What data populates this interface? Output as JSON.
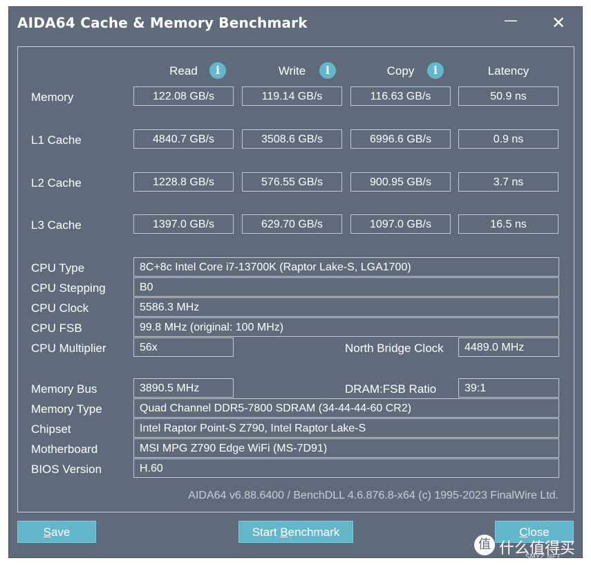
{
  "window": {
    "title": "AIDA64 Cache & Memory Benchmark",
    "minimize_glyph": "—",
    "close_glyph": "✕"
  },
  "columns": {
    "read": "Read",
    "write": "Write",
    "copy": "Copy",
    "latency": "Latency",
    "info_glyph": "i"
  },
  "rows": [
    {
      "label": "Memory",
      "read": "122.08 GB/s",
      "write": "119.14 GB/s",
      "copy": "116.63 GB/s",
      "latency": "50.9 ns"
    },
    {
      "label": "L1 Cache",
      "read": "4840.7 GB/s",
      "write": "3508.6 GB/s",
      "copy": "6996.6 GB/s",
      "latency": "0.9 ns"
    },
    {
      "label": "L2 Cache",
      "read": "1228.8 GB/s",
      "write": "576.55 GB/s",
      "copy": "900.95 GB/s",
      "latency": "3.7 ns"
    },
    {
      "label": "L3 Cache",
      "read": "1397.0 GB/s",
      "write": "629.70 GB/s",
      "copy": "1097.0 GB/s",
      "latency": "16.5 ns"
    }
  ],
  "info": {
    "cpu_type": {
      "label": "CPU Type",
      "value": "8C+8c Intel Core i7-13700K  (Raptor Lake-S, LGA1700)"
    },
    "cpu_stepping": {
      "label": "CPU Stepping",
      "value": "B0"
    },
    "cpu_clock": {
      "label": "CPU Clock",
      "value": "5586.3 MHz"
    },
    "cpu_fsb": {
      "label": "CPU FSB",
      "value": "99.8 MHz  (original: 100 MHz)"
    },
    "cpu_multiplier": {
      "label": "CPU Multiplier",
      "value": "56x"
    },
    "nb_clock": {
      "label": "North Bridge Clock",
      "value": "4489.0 MHz"
    },
    "memory_bus": {
      "label": "Memory Bus",
      "value": "3890.5 MHz"
    },
    "dram_fsb": {
      "label": "DRAM:FSB Ratio",
      "value": "39:1"
    },
    "memory_type": {
      "label": "Memory Type",
      "value": "Quad Channel DDR5-7800 SDRAM  (34-44-44-60 CR2)"
    },
    "chipset": {
      "label": "Chipset",
      "value": "Intel Raptor Point-S Z790, Intel Raptor Lake-S"
    },
    "motherboard": {
      "label": "Motherboard",
      "value": "MSI MPG Z790 Edge WiFi (MS-7D91)"
    },
    "bios": {
      "label": "BIOS Version",
      "value": "H.60"
    }
  },
  "footer": "AIDA64 v6.88.6400 / BenchDLL 4.6.876.8-x64  (c) 1995-2023 FinalWire Ltd.",
  "buttons": {
    "save": {
      "mnemonic": "S",
      "rest": "ave"
    },
    "start": {
      "prefix": "Start ",
      "mnemonic": "B",
      "rest": "enchmark"
    },
    "close": {
      "mnemonic": "C",
      "rest": "lose"
    }
  },
  "watermark": {
    "logo_glyph": "值",
    "text": "什么值得买",
    "sub": "SMYZ.NET"
  }
}
